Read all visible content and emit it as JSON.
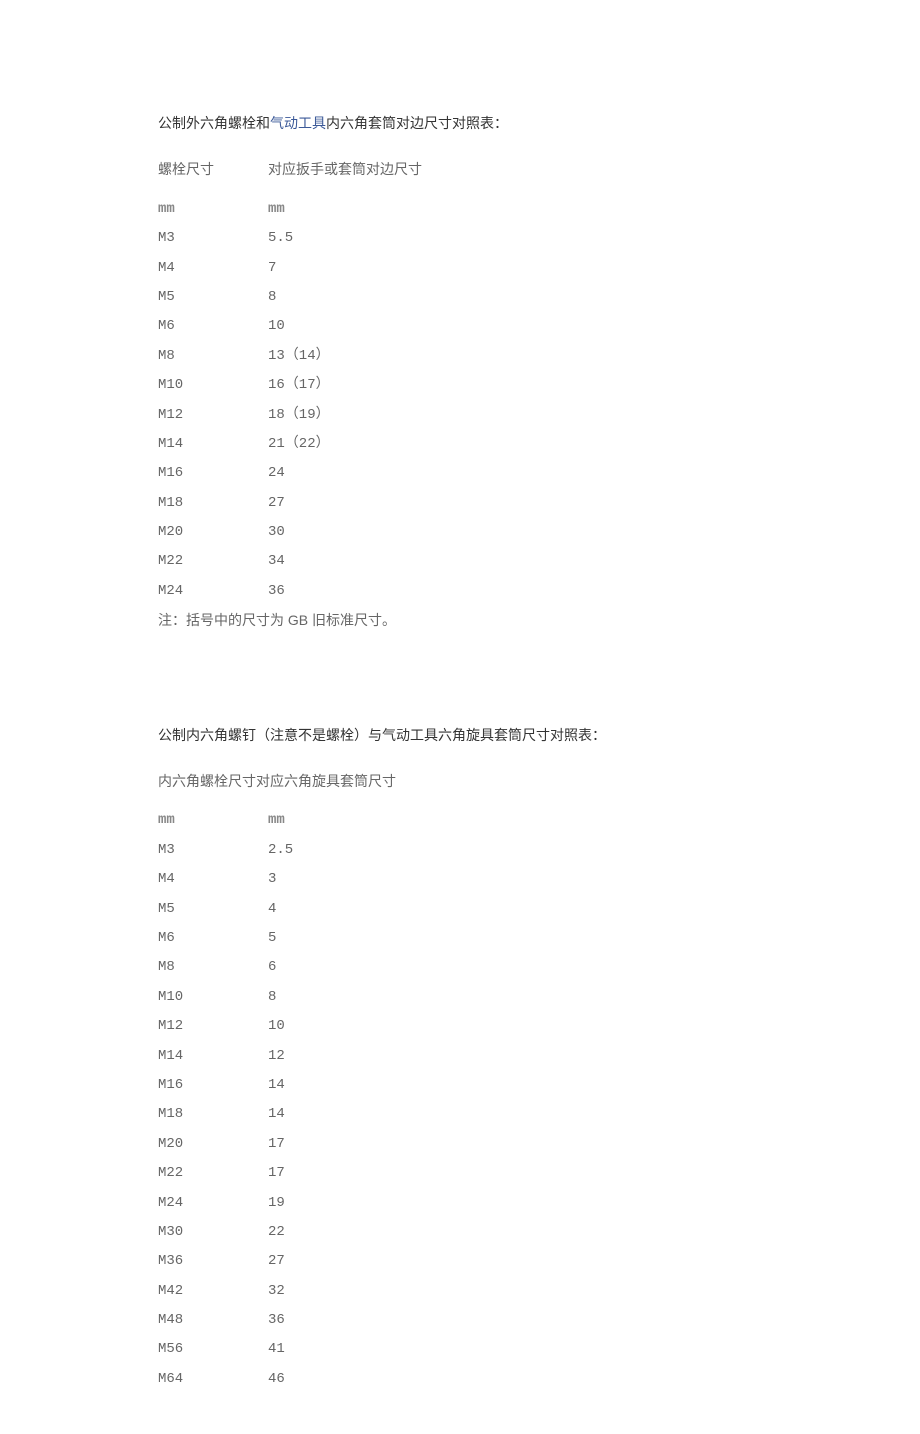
{
  "section1": {
    "title_prefix": "公制外六角螺栓和",
    "title_link": "气动工具",
    "title_suffix": "内六角套筒对边尺寸对照表：",
    "header_col1": "螺栓尺寸",
    "header_col2": "对应扳手或套筒对边尺寸",
    "unit_col1": "mm",
    "unit_col2": "mm",
    "note": "注：括号中的尺寸为 GB 旧标准尺寸。"
  },
  "section2": {
    "title": "公制内六角螺钉（注意不是螺栓）与气动工具六角旋具套筒尺寸对照表：",
    "header_col1": "内六角螺栓尺寸",
    "header_col2": "对应六角旋具套筒尺寸",
    "unit_col1": "mm",
    "unit_col2": "mm"
  },
  "chart_data": [
    {
      "type": "table",
      "title": "公制外六角螺栓和气动工具内六角套筒对边尺寸对照表",
      "columns": [
        "螺栓尺寸 (mm)",
        "对应扳手或套筒对边尺寸 (mm)"
      ],
      "rows": [
        [
          "M3",
          "5.5"
        ],
        [
          "M4",
          "7"
        ],
        [
          "M5",
          "8"
        ],
        [
          "M6",
          "10"
        ],
        [
          "M8",
          "13（14）"
        ],
        [
          "M10",
          "16（17）"
        ],
        [
          "M12",
          "18（19）"
        ],
        [
          "M14",
          "21（22）"
        ],
        [
          "M16",
          "24"
        ],
        [
          "M18",
          "27"
        ],
        [
          "M20",
          "30"
        ],
        [
          "M22",
          "34"
        ],
        [
          "M24",
          "36"
        ]
      ]
    },
    {
      "type": "table",
      "title": "公制内六角螺钉与气动工具六角旋具套筒尺寸对照表",
      "columns": [
        "内六角螺栓尺寸 (mm)",
        "对应六角旋具套筒尺寸 (mm)"
      ],
      "rows": [
        [
          "M3",
          "2.5"
        ],
        [
          "M4",
          "3"
        ],
        [
          "M5",
          "4"
        ],
        [
          "M6",
          "5"
        ],
        [
          "M8",
          "6"
        ],
        [
          "M10",
          "8"
        ],
        [
          "M12",
          "10"
        ],
        [
          "M14",
          "12"
        ],
        [
          "M16",
          "14"
        ],
        [
          "M18",
          "14"
        ],
        [
          "M20",
          "17"
        ],
        [
          "M22",
          "17"
        ],
        [
          "M24",
          "19"
        ],
        [
          "M30",
          "22"
        ],
        [
          "M36",
          "27"
        ],
        [
          "M42",
          "32"
        ],
        [
          "M48",
          "36"
        ],
        [
          "M56",
          "41"
        ],
        [
          "M64",
          "46"
        ]
      ]
    }
  ]
}
